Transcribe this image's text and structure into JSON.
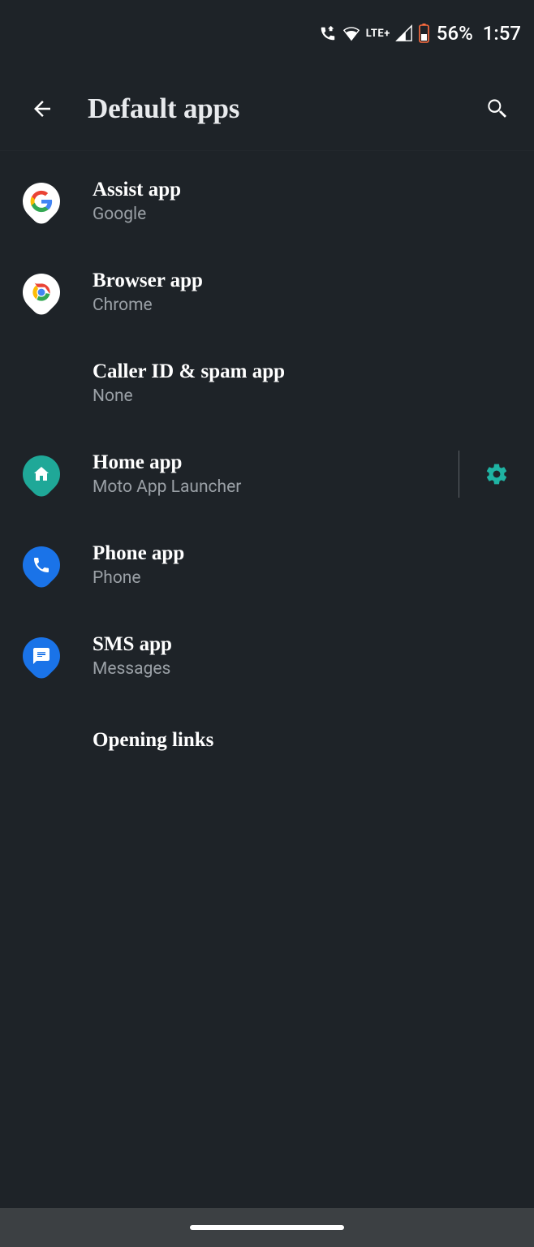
{
  "status": {
    "network_label": "LTE+",
    "battery_percent": "56%",
    "time": "1:57"
  },
  "header": {
    "title": "Default apps"
  },
  "items": [
    {
      "title": "Assist app",
      "sub": "Google"
    },
    {
      "title": "Browser app",
      "sub": "Chrome"
    },
    {
      "title": "Caller ID & spam app",
      "sub": "None"
    },
    {
      "title": "Home app",
      "sub": "Moto App Launcher"
    },
    {
      "title": "Phone app",
      "sub": "Phone"
    },
    {
      "title": "SMS app",
      "sub": "Messages"
    },
    {
      "title": "Opening links"
    }
  ],
  "colors": {
    "accent_teal": "#1fa898",
    "accent_blue": "#1a73e8",
    "gear": "#1fb3a3"
  }
}
